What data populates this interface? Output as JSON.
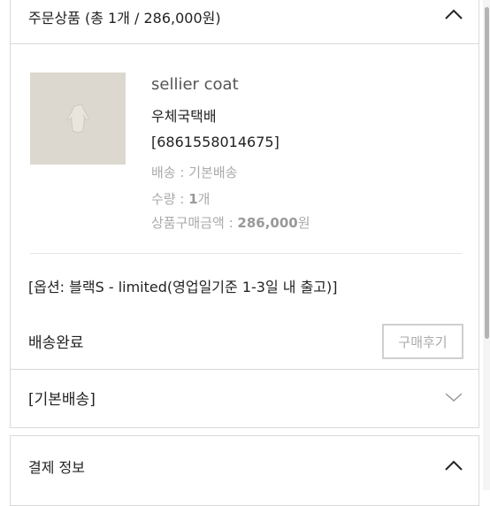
{
  "order_items": {
    "header_title": "주문상품 (총 1개 / 286,000원)",
    "product": {
      "name": "sellier coat",
      "shipping_method": "우체국택배",
      "order_number": "[6861558014675]",
      "shipping_label": "배송 :",
      "shipping_value": "기본배송",
      "quantity_label": "수량 :",
      "quantity_value": "1",
      "quantity_unit": "개",
      "amount_label": "상품구매금액 :",
      "amount_value": "286,000",
      "amount_unit": "원"
    },
    "option_text": "[옵션: 블랙S - limited(영업일기준 1-3일 내 출고)]",
    "status": "배송완료",
    "review_button": "구매후기",
    "shipping_section_label": "[기본배송]"
  },
  "payment": {
    "header_title": "결제 정보"
  }
}
